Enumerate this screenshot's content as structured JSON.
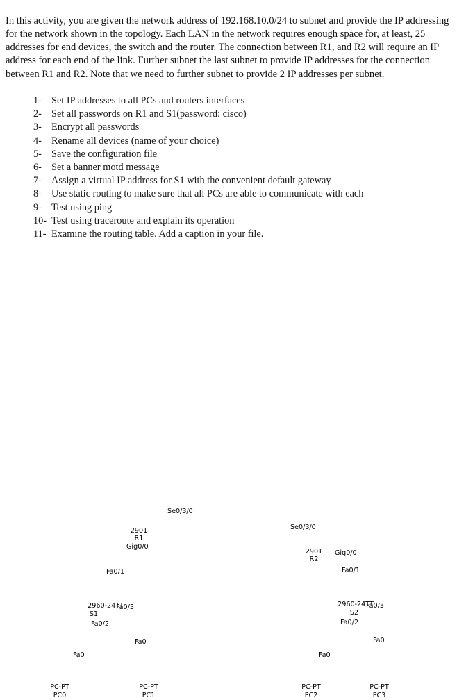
{
  "document": {
    "intro_paragraph": "In this activity, you are given the network address of 192.168.10.0/24 to subnet and provide the IP addressing for the network shown in the topology. Each LAN in the network requires enough space for, at least, 25 addresses for end devices, the switch and the router. The connection between R1, and R2 will require an IP address for each end of the link. Further subnet the last subnet to provide IP addresses for the connection between R1 and R2. Note that we need to further subnet to provide 2 IP addresses per subnet.",
    "tasks": [
      {
        "number": "1-",
        "text": "Set IP addresses to all PCs and routers interfaces"
      },
      {
        "number": "2-",
        "text": "Set all passwords on R1 and S1(password: cisco)"
      },
      {
        "number": "3-",
        "text": "Encrypt all passwords"
      },
      {
        "number": "4-",
        "text": "Rename all devices (name of your choice)"
      },
      {
        "number": "5-",
        "text": "Save the configuration file"
      },
      {
        "number": "6-",
        "text": "Set a banner motd message"
      },
      {
        "number": "7-",
        "text": "Assign a virtual IP address for S1 with the convenient default gateway"
      },
      {
        "number": "8-",
        "text": "Use static routing to make sure that all PCs are able to communicate with each"
      },
      {
        "number": "9-",
        "text": "Test using ping"
      },
      {
        "number": "10-",
        "text": "Test using traceroute and explain its operation"
      },
      {
        "number": "11-",
        "text": "Examine the routing table. Add a caption in your file."
      }
    ]
  },
  "topology": {
    "devices": {
      "r1": {
        "model": "2901",
        "name": "R1"
      },
      "r2": {
        "model": "2901",
        "name": "R2"
      },
      "s1": {
        "model": "2960-24TT",
        "name": "S1"
      },
      "s2": {
        "model": "2960-24TT",
        "name": "S2"
      },
      "pc0": {
        "model": "PC-PT",
        "name": "PC0"
      },
      "pc1": {
        "model": "PC-PT",
        "name": "PC1"
      },
      "pc2": {
        "model": "PC-PT",
        "name": "PC2"
      },
      "pc3": {
        "model": "PC-PT",
        "name": "PC3"
      }
    },
    "interfaces": {
      "r1_serial": "Se0/3/0",
      "r2_serial": "Se0/3/0",
      "r1_gig": "Gig0/0",
      "r2_gig": "Gig0/0",
      "s1_uplink": "Fa0/1",
      "s2_uplink": "Fa0/1",
      "s1_port2": "Fa0/2",
      "s1_port3": "Fa0/3",
      "s2_port2": "Fa0/2",
      "s2_port3": "Fa0/3",
      "pc0_nic": "Fa0",
      "pc1_nic": "Fa0",
      "pc2_nic": "Fa0",
      "pc3_nic": "Fa0"
    },
    "icons": {
      "dce_clock": "clock-icon"
    },
    "colors": {
      "serial_link": "#ff0000",
      "ethernet_link": "#000000",
      "router_port_marker": "#cc1111",
      "switch_port_marker": "#66cc33",
      "device_body": "#5a98ac",
      "device_body_dark": "#2d6275",
      "device_top": "#9fd0dd"
    }
  }
}
